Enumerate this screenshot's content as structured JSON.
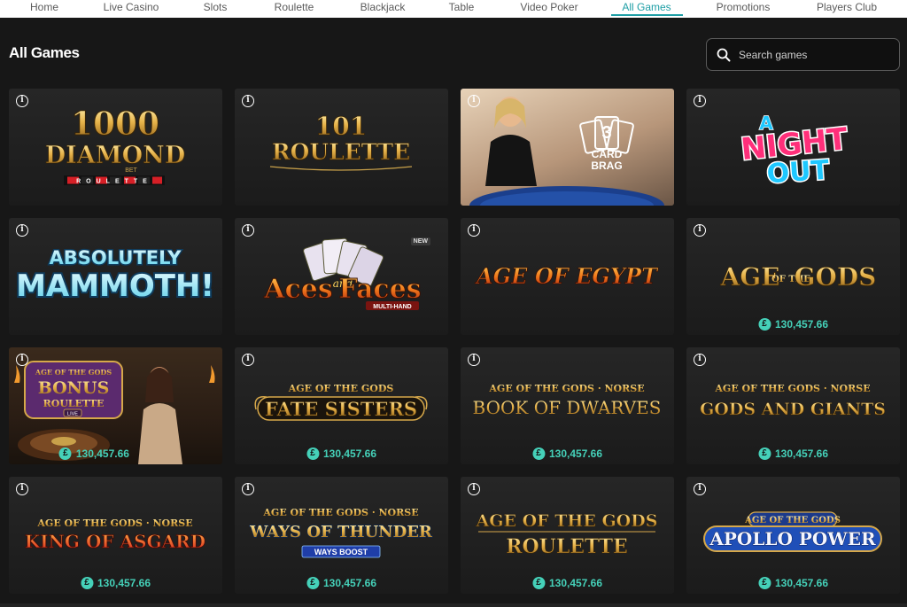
{
  "nav": {
    "items": [
      {
        "label": "Home",
        "active": false
      },
      {
        "label": "Live Casino",
        "active": false
      },
      {
        "label": "Slots",
        "active": false
      },
      {
        "label": "Roulette",
        "active": false
      },
      {
        "label": "Blackjack",
        "active": false
      },
      {
        "label": "Table",
        "active": false
      },
      {
        "label": "Video Poker",
        "active": false
      },
      {
        "label": "All Games",
        "active": true
      },
      {
        "label": "Promotions",
        "active": false
      },
      {
        "label": "Players Club",
        "active": false
      }
    ]
  },
  "page": {
    "title": "All Games"
  },
  "search": {
    "placeholder": "Search games",
    "icon": "search-icon"
  },
  "colors": {
    "accent": "#1f9fa6",
    "jackpot": "#45d1b9",
    "background": "#171717",
    "card": "#222222"
  },
  "games": [
    {
      "logo_lines": [
        "1000",
        "DIAMOND",
        "BET",
        "ROULETTE"
      ],
      "jackpot": ""
    },
    {
      "logo_lines": [
        "101",
        "ROULETTE"
      ],
      "jackpot": ""
    },
    {
      "logo_lines": [
        "3",
        "CARD",
        "BRAG"
      ],
      "jackpot": ""
    },
    {
      "logo_lines": [
        "A",
        "NIGHT",
        "OUT"
      ],
      "jackpot": ""
    },
    {
      "logo_lines": [
        "ABSOLUTELY",
        "MAMMOTH!"
      ],
      "jackpot": ""
    },
    {
      "logo_lines": [
        "Aces",
        "and",
        "Faces",
        "MULTI-HAND"
      ],
      "badge": "NEW",
      "jackpot": ""
    },
    {
      "logo_lines": [
        "AGE OF EGYPT"
      ],
      "jackpot": ""
    },
    {
      "logo_lines": [
        "AGE",
        "OF THE",
        "GODS"
      ],
      "jackpot": "130,457.66"
    },
    {
      "logo_lines": [
        "AGE OF THE GODS",
        "BONUS",
        "ROULETTE",
        "LIVE"
      ],
      "jackpot": "130,457.66"
    },
    {
      "logo_lines": [
        "AGE OF THE GODS",
        "FATE SISTERS"
      ],
      "jackpot": "130,457.66"
    },
    {
      "logo_lines": [
        "AGE OF THE GODS · NORSE",
        "BOOK OF DWARVES"
      ],
      "jackpot": "130,457.66"
    },
    {
      "logo_lines": [
        "AGE OF THE GODS · NORSE",
        "GODS AND GIANTS"
      ],
      "jackpot": "130,457.66"
    },
    {
      "logo_lines": [
        "AGE OF THE GODS · NORSE",
        "KING OF ASGARD"
      ],
      "jackpot": "130,457.66"
    },
    {
      "logo_lines": [
        "AGE OF THE GODS · NORSE",
        "WAYS OF THUNDER",
        "WAYS BOOST"
      ],
      "jackpot": "130,457.66"
    },
    {
      "logo_lines": [
        "AGE OF THE GODS",
        "ROULETTE"
      ],
      "jackpot": "130,457.66"
    },
    {
      "logo_lines": [
        "AGE OF THE GODS",
        "APOLLO POWER"
      ],
      "jackpot": "130,457.66"
    }
  ],
  "info_icon": "info-icon",
  "jackpot_icon_glyph": "£"
}
